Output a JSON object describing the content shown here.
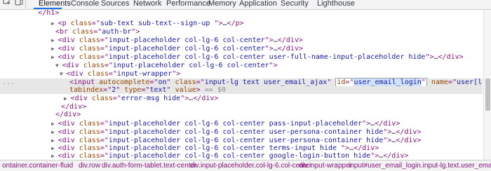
{
  "tabs": [
    {
      "label": "Elements",
      "active": true
    },
    {
      "label": "Console"
    },
    {
      "label": "Sources"
    },
    {
      "label": "Network"
    },
    {
      "label": "Performance"
    },
    {
      "label": "Memory"
    },
    {
      "label": "Application"
    },
    {
      "label": "Security"
    },
    {
      "label": "Lighthouse"
    }
  ],
  "icons": {
    "inspect": "inspect-element-icon",
    "device": "device-toolbar-icon"
  },
  "dom_lines": [
    {
      "text_parts": [
        {
          "t": "         </h1>",
          "c": "tag"
        }
      ]
    },
    {
      "arrow": "▶",
      "text_parts": [
        {
          "t": "<p ",
          "c": "tag"
        },
        {
          "t": "class",
          "c": "an"
        },
        {
          "t": "=\"",
          "c": "tag"
        },
        {
          "t": "sub-text sub-text--sign-up ",
          "c": "av"
        },
        {
          "t": "\">",
          "c": "tag"
        },
        {
          "t": "…",
          "c": "ell"
        },
        {
          "t": "</p>",
          "c": "tag"
        }
      ]
    },
    {
      "text_parts": [
        {
          "t": "<br ",
          "c": "tag"
        },
        {
          "t": "class",
          "c": "an"
        },
        {
          "t": "=\"",
          "c": "tag"
        },
        {
          "t": "auth-br",
          "c": "av"
        },
        {
          "t": "\">",
          "c": "tag"
        }
      ]
    },
    {
      "arrow": "▶",
      "text_parts": [
        {
          "t": "<div ",
          "c": "tag"
        },
        {
          "t": "class",
          "c": "an"
        },
        {
          "t": "=\"",
          "c": "tag"
        },
        {
          "t": "input-placeholder col-lg-6 col-center",
          "c": "av"
        },
        {
          "t": "\">",
          "c": "tag"
        },
        {
          "t": "…",
          "c": "ell"
        },
        {
          "t": "</div>",
          "c": "tag"
        }
      ]
    },
    {
      "arrow": "▶",
      "text_parts": [
        {
          "t": "<div ",
          "c": "tag"
        },
        {
          "t": "class",
          "c": "an"
        },
        {
          "t": "=\"",
          "c": "tag"
        },
        {
          "t": "input-placeholder col-lg-6 col-center",
          "c": "av"
        },
        {
          "t": "\">",
          "c": "tag"
        },
        {
          "t": "…",
          "c": "ell"
        },
        {
          "t": "</div>",
          "c": "tag"
        }
      ]
    },
    {
      "arrow": "▶",
      "text_parts": [
        {
          "t": "<div ",
          "c": "tag"
        },
        {
          "t": "class",
          "c": "an"
        },
        {
          "t": "=\"",
          "c": "tag"
        },
        {
          "t": "input-placeholder col-lg-6 col-center user-full-name-input-placeholder hide",
          "c": "av"
        },
        {
          "t": "\">",
          "c": "tag"
        },
        {
          "t": "…",
          "c": "ell"
        },
        {
          "t": "</div>",
          "c": "tag"
        }
      ]
    },
    {
      "arrow": "▼",
      "text_parts": [
        {
          "t": "<div ",
          "c": "tag"
        },
        {
          "t": "class",
          "c": "an"
        },
        {
          "t": "=\"",
          "c": "tag"
        },
        {
          "t": "input-placeholder col-lg-6 col-center",
          "c": "av"
        },
        {
          "t": "\">",
          "c": "tag"
        }
      ]
    },
    {
      "arrow": "▼",
      "text_parts": [
        {
          "t": "<div ",
          "c": "tag"
        },
        {
          "t": "class",
          "c": "an"
        },
        {
          "t": "=\"",
          "c": "tag"
        },
        {
          "t": "input-wrapper",
          "c": "av"
        },
        {
          "t": "\">",
          "c": "tag"
        }
      ]
    },
    {
      "selected": true,
      "text_parts": [
        {
          "t": "<input ",
          "c": "tag"
        },
        {
          "t": "autocomplete",
          "c": "an"
        },
        {
          "t": "=\"",
          "c": "tag"
        },
        {
          "t": "on",
          "c": "av"
        },
        {
          "t": "\" ",
          "c": "tag"
        },
        {
          "t": "class",
          "c": "an"
        },
        {
          "t": "=\"",
          "c": "tag"
        },
        {
          "t": "input-lg text user_email_ajax",
          "c": "av"
        },
        {
          "t": "\" ",
          "c": "tag"
        }
      ],
      "idbox": {
        "attr": "id",
        "value": "user_email_login"
      },
      "tail_parts": [
        {
          "t": " ",
          "c": "tag"
        },
        {
          "t": "name",
          "c": "an"
        },
        {
          "t": "=\"",
          "c": "tag"
        },
        {
          "t": "user[login]",
          "c": "av"
        },
        {
          "t": "\" ",
          "c": "tag"
        },
        {
          "t": "placeholder",
          "c": "an"
        },
        {
          "t": "=\"",
          "c": "tag"
        },
        {
          "t": "Business Email",
          "c": "av"
        },
        {
          "t": "\"",
          "c": "tag"
        }
      ]
    },
    {
      "selected": true,
      "text_parts": [
        {
          "t": "tabindex",
          "c": "an"
        },
        {
          "t": "=\"",
          "c": "tag"
        },
        {
          "t": "2",
          "c": "av"
        },
        {
          "t": "\" ",
          "c": "tag"
        },
        {
          "t": "type",
          "c": "an"
        },
        {
          "t": "=\"",
          "c": "tag"
        },
        {
          "t": "text",
          "c": "av"
        },
        {
          "t": "\" ",
          "c": "tag"
        },
        {
          "t": "value",
          "c": "an"
        },
        {
          "t": "> ",
          "c": "tag"
        },
        {
          "t": "== $0",
          "c": "dollar"
        }
      ]
    },
    {
      "arrow": "▶",
      "text_parts": [
        {
          "t": "<div ",
          "c": "tag"
        },
        {
          "t": "class",
          "c": "an"
        },
        {
          "t": "=\"",
          "c": "tag"
        },
        {
          "t": "error-msg hide",
          "c": "av"
        },
        {
          "t": "\">",
          "c": "tag"
        },
        {
          "t": "…",
          "c": "ell"
        },
        {
          "t": "</div>",
          "c": "tag"
        }
      ]
    },
    {
      "text_parts": [
        {
          "t": "</div>",
          "c": "tag"
        }
      ]
    },
    {
      "text_parts": [
        {
          "t": "</div>",
          "c": "tag"
        }
      ]
    },
    {
      "arrow": "▶",
      "text_parts": [
        {
          "t": "<div ",
          "c": "tag"
        },
        {
          "t": "class",
          "c": "an"
        },
        {
          "t": "=\"",
          "c": "tag"
        },
        {
          "t": "input-placeholder col-lg-6 col-center pass-input-placeholder",
          "c": "av"
        },
        {
          "t": "\">",
          "c": "tag"
        },
        {
          "t": "…",
          "c": "ell"
        },
        {
          "t": "</div>",
          "c": "tag"
        }
      ]
    },
    {
      "arrow": "▶",
      "text_parts": [
        {
          "t": "<div ",
          "c": "tag"
        },
        {
          "t": "class",
          "c": "an"
        },
        {
          "t": "=\"",
          "c": "tag"
        },
        {
          "t": "input-placeholder col-lg-6 col-center user-persona-container hide",
          "c": "av"
        },
        {
          "t": "\">",
          "c": "tag"
        },
        {
          "t": "…",
          "c": "ell"
        },
        {
          "t": "</div>",
          "c": "tag"
        }
      ]
    },
    {
      "arrow": "▶",
      "text_parts": [
        {
          "t": "<div ",
          "c": "tag"
        },
        {
          "t": "class",
          "c": "an"
        },
        {
          "t": "=\"",
          "c": "tag"
        },
        {
          "t": "input-placeholder col-lg-6 col-center user-persona-container hide",
          "c": "av"
        },
        {
          "t": "\">",
          "c": "tag"
        },
        {
          "t": "…",
          "c": "ell"
        },
        {
          "t": "</div>",
          "c": "tag"
        }
      ]
    },
    {
      "arrow": "▶",
      "text_parts": [
        {
          "t": "<div ",
          "c": "tag"
        },
        {
          "t": "class",
          "c": "an"
        },
        {
          "t": "=\"",
          "c": "tag"
        },
        {
          "t": "input-placeholder col-lg-6 col-center terms-input hide ",
          "c": "av"
        },
        {
          "t": "\">",
          "c": "tag"
        },
        {
          "t": "…",
          "c": "ell"
        },
        {
          "t": "</div>",
          "c": "tag"
        }
      ]
    },
    {
      "arrow": "▶",
      "text_parts": [
        {
          "t": "<div ",
          "c": "tag"
        },
        {
          "t": "class",
          "c": "an"
        },
        {
          "t": "=\"",
          "c": "tag"
        },
        {
          "t": "input-placeholder col-lg-6 col-center google-login-button hide",
          "c": "av"
        },
        {
          "t": "\">",
          "c": "tag"
        },
        {
          "t": "…",
          "c": "ell"
        },
        {
          "t": "</div>",
          "c": "tag"
        }
      ]
    },
    {
      "arrow": "▶",
      "text_parts": [
        {
          "t": "<div ",
          "c": "tag"
        },
        {
          "t": "class",
          "c": "an"
        },
        {
          "t": "=\"",
          "c": "tag"
        },
        {
          "t": "input-placeholder col-lg-6 col-center",
          "c": "av"
        },
        {
          "t": "\">",
          "c": "tag"
        },
        {
          "t": "…",
          "c": "ell"
        },
        {
          "t": "</div>",
          "c": "tag"
        }
      ]
    }
  ],
  "gutter_marker": "...",
  "breadcrumbs": [
    {
      "label": "ontainer.container-fluid"
    },
    {
      "label": "div.row"
    },
    {
      "label": "div.auth-form-tablet.text-center."
    },
    {
      "label": "div.input-placeholder.col-lg-6.col-center"
    },
    {
      "label": "div.input-wrapper"
    },
    {
      "label": "input#user_email_login.input-lg.text.user_email_ajax",
      "active": true
    }
  ],
  "colors": {
    "accent": "#1a73e8",
    "tag": "#881280",
    "attr_name": "#994500",
    "attr_value": "#1a1aa6"
  }
}
